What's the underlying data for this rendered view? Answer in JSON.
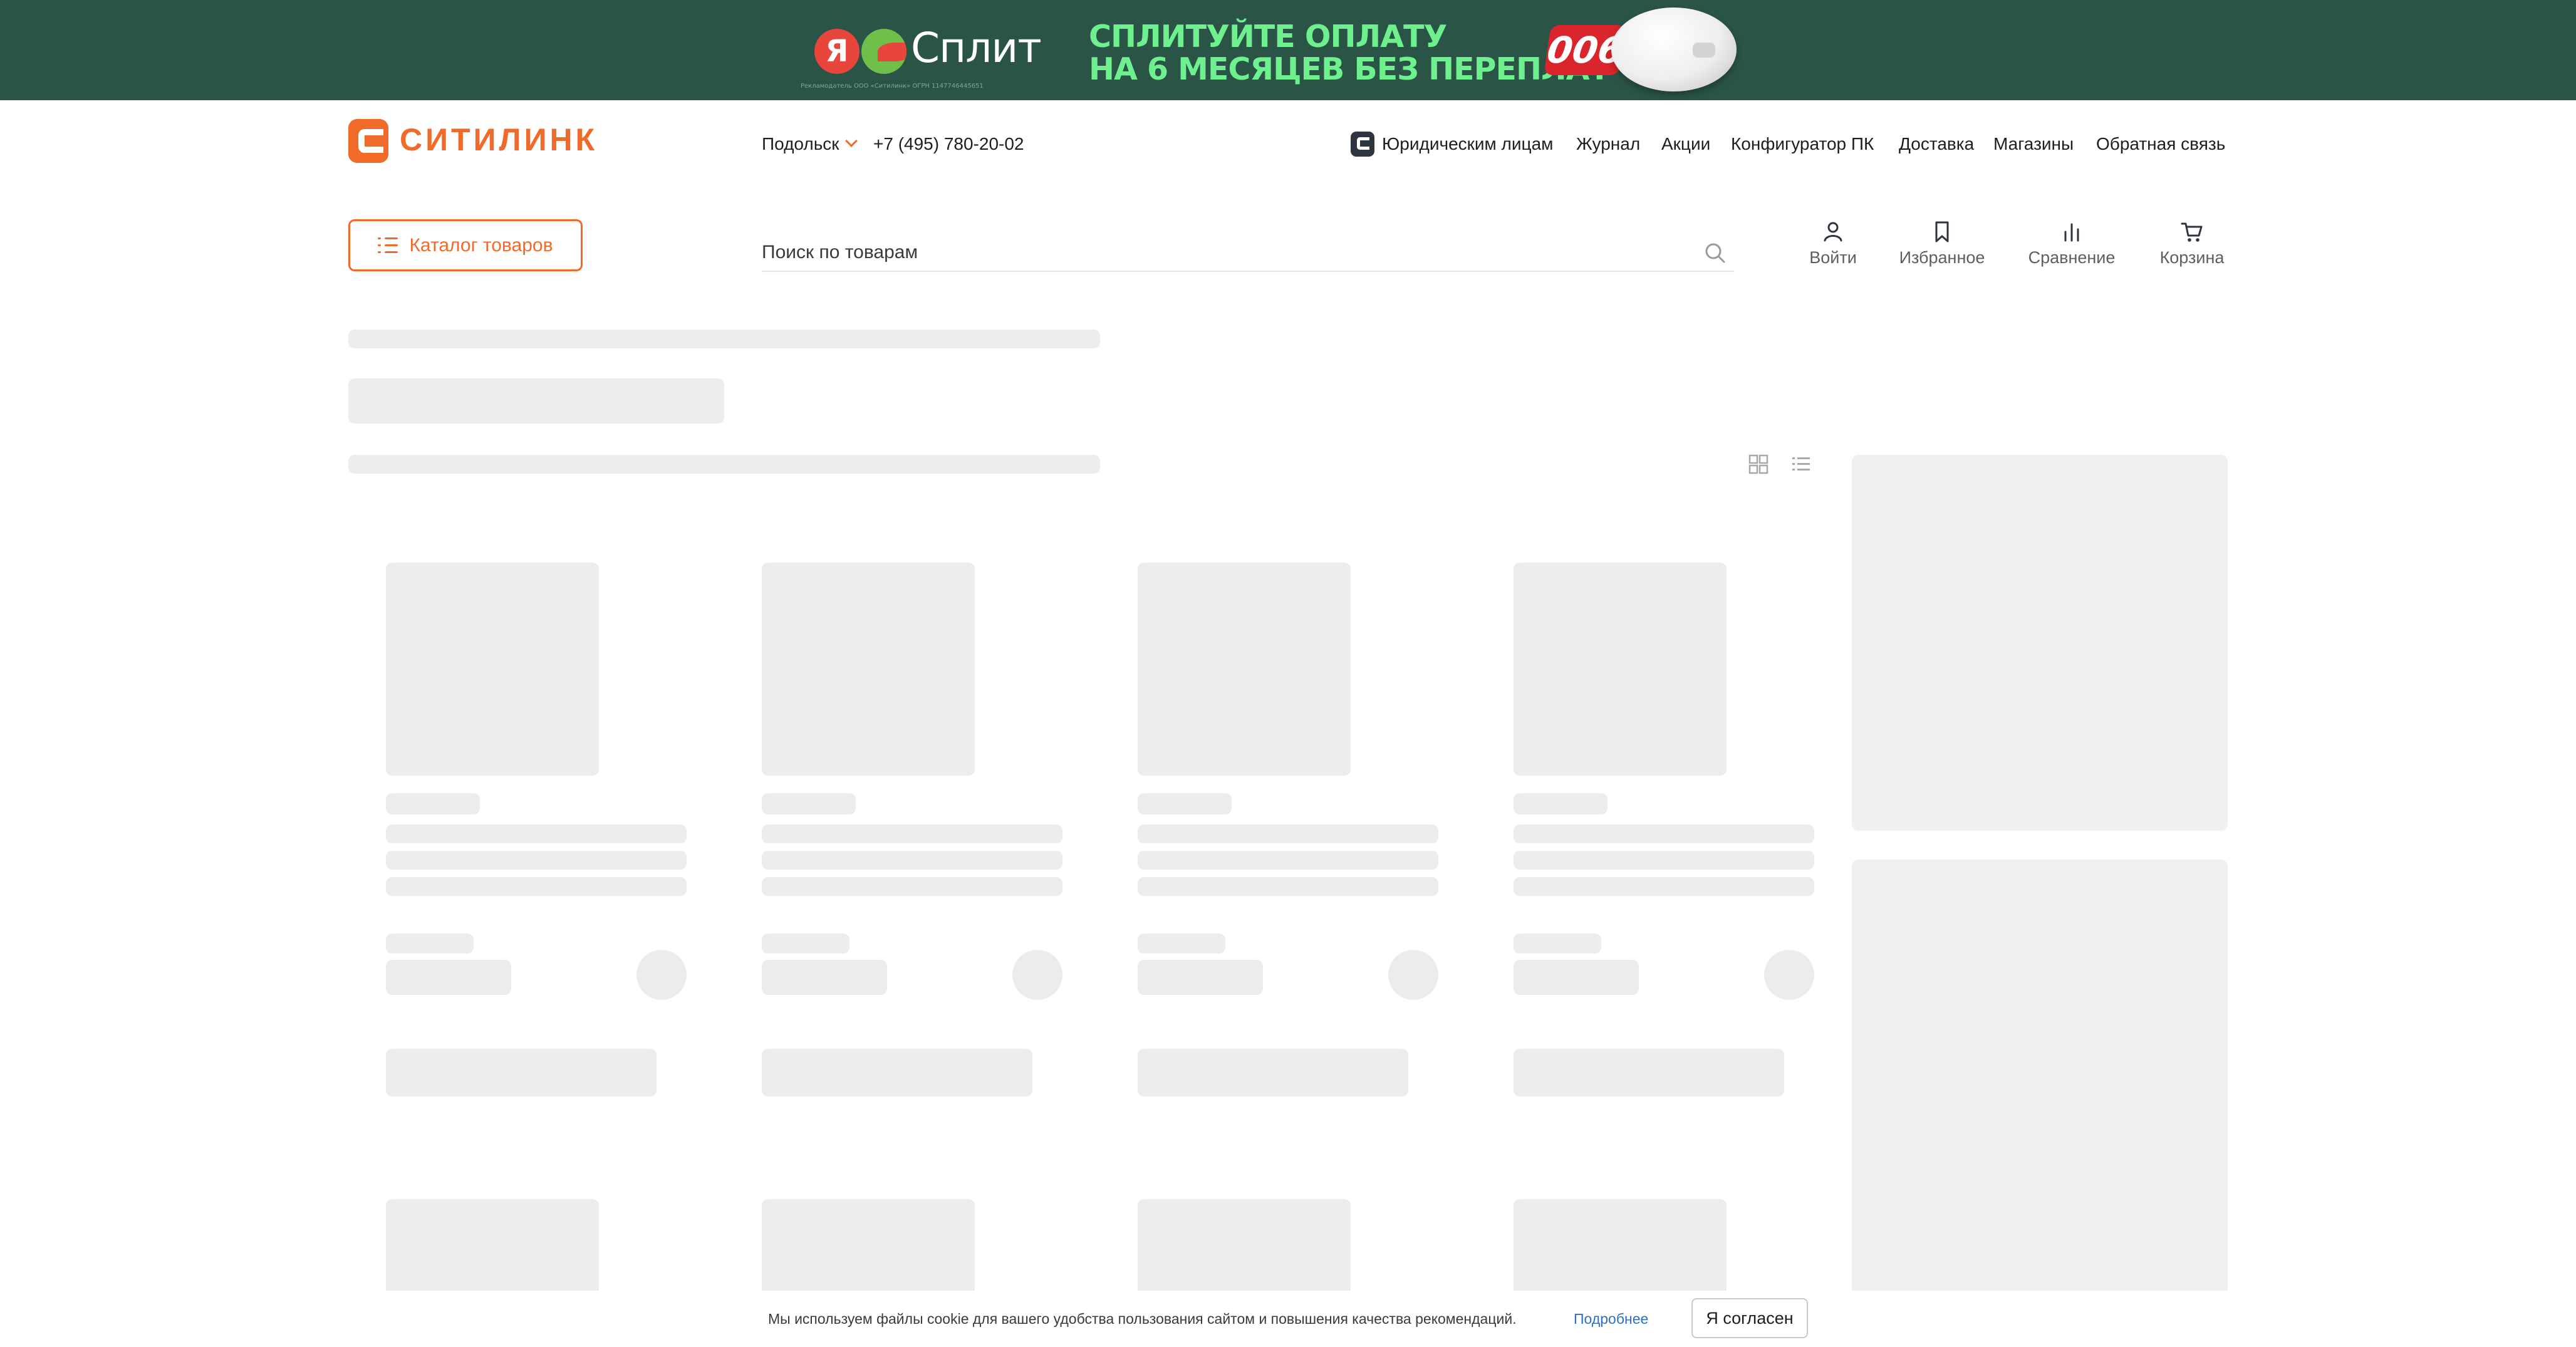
{
  "banner": {
    "logo_letter": "Я",
    "brand": "Сплит",
    "fine_print": "Рекламодатель ООО «Ситилинк» ОГРН 1147746445651",
    "headline_line1": "СПЛИТУЙТЕ ОПЛАТУ",
    "headline_line2": "НА 6 МЕСЯЦЕВ БЕЗ ПЕРЕПЛАТ",
    "badge": "006",
    "colors": {
      "background": "#2a5446",
      "headline": "#6ff08e",
      "badge": "#d9252b"
    }
  },
  "header": {
    "logo_text": "СИТИЛИНК",
    "city": "Подольск",
    "phone": "+7 (495) 780-20-02",
    "nav": {
      "business": "Юридическим лицам",
      "journal": "Журнал",
      "promos": "Акции",
      "pc_configurator": "Конфигуратор ПК",
      "delivery": "Доставка",
      "stores": "Магазины",
      "feedback": "Обратная связь"
    },
    "catalog_button": "Каталог товаров",
    "search_placeholder": "Поиск по товарам",
    "actions": {
      "login": "Войти",
      "favorites": "Избранное",
      "compare": "Сравнение",
      "cart": "Корзина"
    }
  },
  "cookie": {
    "text": "Мы используем файлы cookie для вашего удобства пользования сайтом и повышения качества рекомендаций.",
    "link": "Подробнее",
    "accept": "Я согласен"
  },
  "colors": {
    "accent": "#f06a2a",
    "skeleton": "#ececec",
    "link": "#2f6fbf"
  },
  "icons": [
    "list-icon",
    "search-icon",
    "user-icon",
    "bookmark-icon",
    "chart-bars-icon",
    "cart-icon",
    "grid-view-icon",
    "list-view-icon"
  ]
}
